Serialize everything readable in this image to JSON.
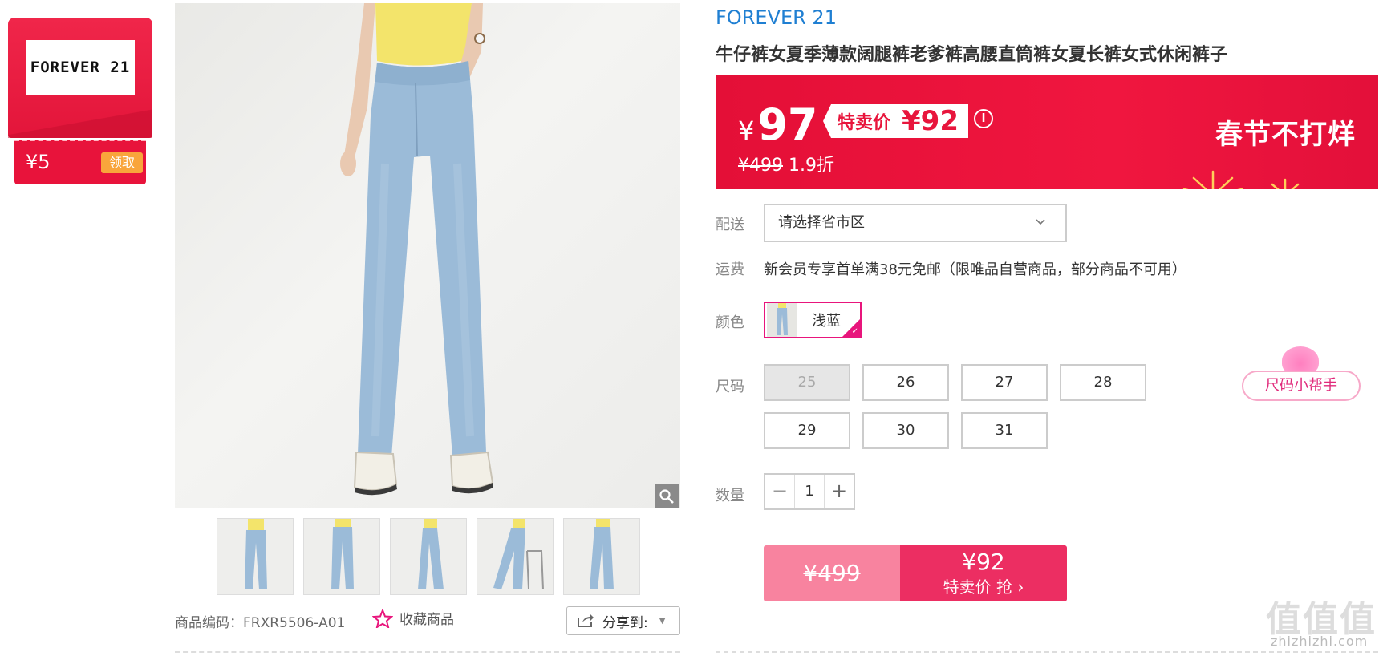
{
  "coupon": {
    "brand_logo": "FOREVER 21",
    "amount": "¥5",
    "claim_label": "领取"
  },
  "gallery": {
    "main_image": "model-wearing-light-blue-wide-leg-jeans",
    "thumbnails": [
      "thumb-front-view",
      "thumb-front-view-2",
      "thumb-side-view",
      "thumb-side-chair-view",
      "thumb-side-view-2"
    ],
    "zoom_icon": "magnifier-icon"
  },
  "sku": {
    "label": "商品编码：FRXR5506-A01",
    "favorite_label": "收藏商品",
    "share_label": "分享到:"
  },
  "product": {
    "brand": "FOREVER 21",
    "title": "牛仔裤女夏季薄款阔腿裤老爹裤高腰直筒裤女夏长裤女式休闲裤子"
  },
  "price": {
    "currency": "¥",
    "current": "97",
    "special_label": "特卖价",
    "special_price": "¥92",
    "info_icon": "i",
    "original": "¥499",
    "discount": "1.9折",
    "festival": "春节不打烊"
  },
  "delivery": {
    "label": "配送",
    "placeholder": "请选择省市区"
  },
  "shipping": {
    "label": "运费",
    "text": "新会员专享首单满38元免邮（限唯品自营商品，部分商品不可用）"
  },
  "color": {
    "label": "颜色",
    "selected": "浅蓝"
  },
  "size": {
    "label": "尺码",
    "options": [
      "25",
      "26",
      "27",
      "28",
      "29",
      "30",
      "31"
    ],
    "disabled": [
      "25"
    ],
    "helper_label": "尺码小帮手"
  },
  "quantity": {
    "label": "数量",
    "minus": "−",
    "value": "1",
    "plus": "+"
  },
  "buy": {
    "original_price": "¥499",
    "price": "¥92",
    "action": "特卖价 抢 ›"
  },
  "watermark": {
    "big": "值值值",
    "small": "zhizhizhi.com"
  },
  "colors": {
    "brand_red": "#e40f37",
    "link_blue": "#1f7fd2",
    "accent_pink": "#e8157c",
    "buy_pink": "#ec2e62"
  }
}
